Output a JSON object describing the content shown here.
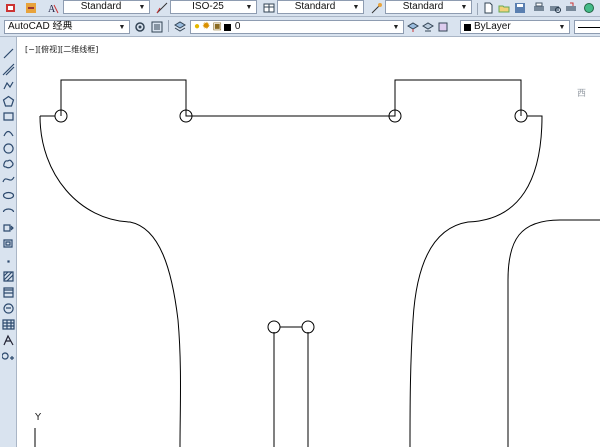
{
  "toolbar_top": {
    "text_style": "Standard",
    "dim_style": "ISO-25",
    "table_style": "Standard",
    "multileader_style": "Standard"
  },
  "toolbar_second": {
    "workspace": "AutoCAD 经典",
    "layer": "0",
    "color": "ByLayer"
  },
  "viewport": {
    "label": "[−][俯视][二维线框]",
    "viewcube_label": "西",
    "ucs_axis": "Y"
  },
  "left_tools": [
    "line-icon",
    "construction-line-icon",
    "polyline-icon",
    "polygon-icon",
    "rectangle-icon",
    "arc-icon",
    "circle-icon",
    "revision-cloud-icon",
    "spline-icon",
    "ellipse-icon",
    "ellipse-arc-icon",
    "insert-block-icon",
    "make-block-icon",
    "point-icon",
    "hatch-icon",
    "gradient-icon",
    "region-icon",
    "table-icon",
    "multiline-text-icon",
    "add-selected-icon"
  ]
}
